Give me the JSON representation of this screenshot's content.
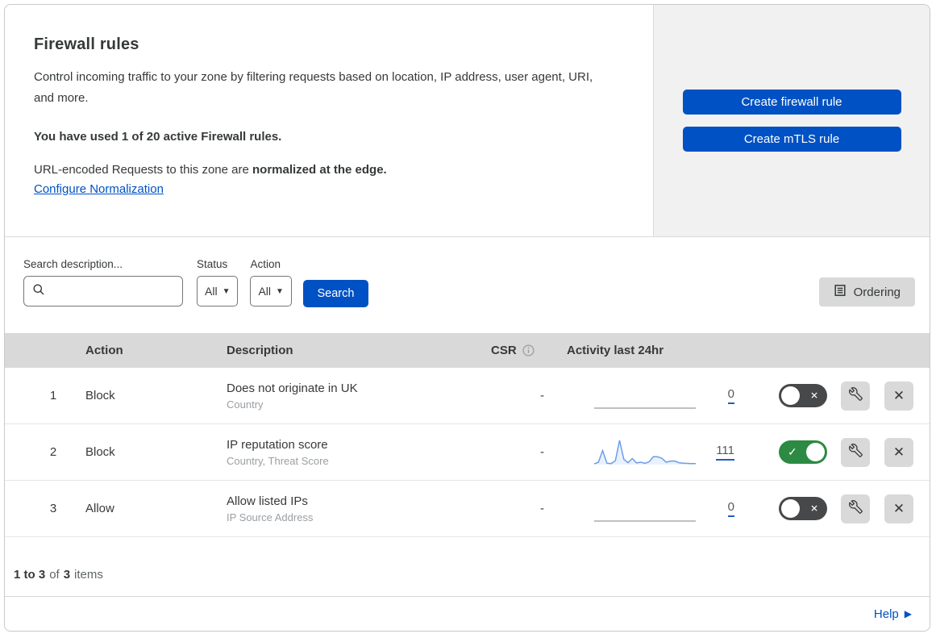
{
  "header": {
    "title": "Firewall rules",
    "description": "Control incoming traffic to your zone by filtering requests based on location, IP address, user agent, URI, and more.",
    "usage_bold": "You have used 1 of 20 active Firewall rules.",
    "normalization_prefix": "URL-encoded Requests to this zone are ",
    "normalization_bold": "normalized at the edge.",
    "normalization_link": "Configure Normalization",
    "buttons": {
      "create_firewall": "Create firewall rule",
      "create_mtls": "Create mTLS rule"
    }
  },
  "filters": {
    "search_label": "Search description...",
    "status_label": "Status",
    "status_value": "All",
    "action_label": "Action",
    "action_value": "All",
    "search_button": "Search",
    "ordering_button": "Ordering"
  },
  "table": {
    "columns": {
      "action": "Action",
      "description": "Description",
      "csr": "CSR",
      "activity": "Activity last 24hr"
    },
    "rows": [
      {
        "priority": "1",
        "action": "Block",
        "description": "Does not originate in UK",
        "criteria": "Country",
        "csr": "-",
        "activity_count": "0",
        "enabled": false,
        "sparkline": []
      },
      {
        "priority": "2",
        "action": "Block",
        "description": "IP reputation score",
        "criteria": "Country, Threat Score",
        "csr": "-",
        "activity_count": "111",
        "enabled": true,
        "sparkline": [
          3,
          10,
          58,
          6,
          4,
          16,
          100,
          22,
          8,
          25,
          7,
          10,
          5,
          12,
          33,
          32,
          26,
          10,
          14,
          15,
          8,
          6,
          5,
          4,
          4
        ]
      },
      {
        "priority": "3",
        "action": "Allow",
        "description": "Allow listed IPs",
        "criteria": "IP Source Address",
        "csr": "-",
        "activity_count": "0",
        "enabled": false,
        "sparkline": []
      }
    ]
  },
  "footer": {
    "range_bold": "1 to 3",
    "of_text": "of",
    "total_bold": "3",
    "items_text": "items",
    "help_link": "Help"
  },
  "colors": {
    "accent_blue": "#0051c3",
    "toggle_on_green": "#2c8a43",
    "toggle_off_gray": "#47484a",
    "sparkline_blue": "#6d9ee8",
    "flat_line_gray": "#9a9a9a"
  }
}
